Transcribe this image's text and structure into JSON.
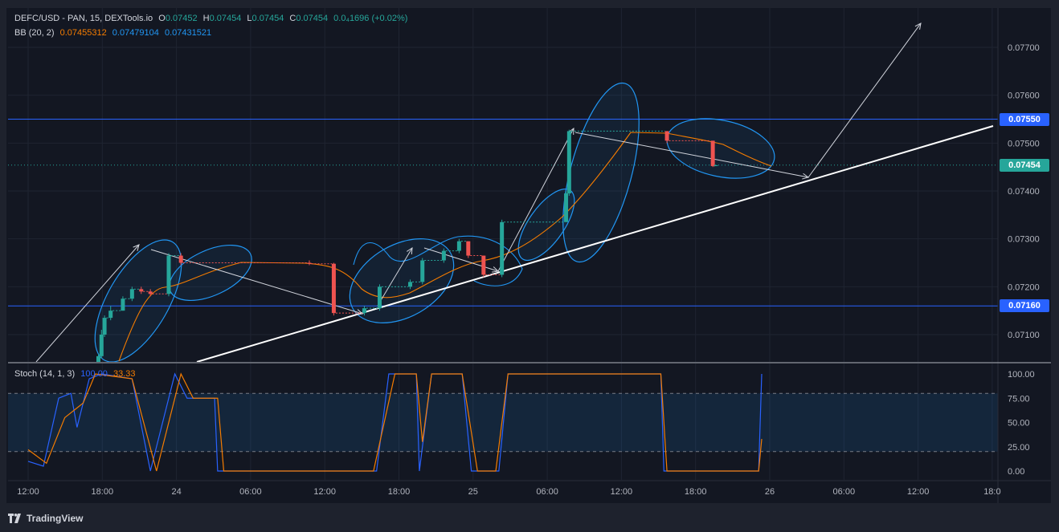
{
  "header": {
    "symbol": "DEFC/USD - PAN, 15, DEXTools.io",
    "o_label": "O",
    "o_value": "0.07452",
    "h_label": "H",
    "h_value": "0.07454",
    "l_label": "L",
    "l_value": "0.07454",
    "c_label": "C",
    "c_value": "0.07454",
    "change": "0.0₄1696 (+0.02%)"
  },
  "bb": {
    "label": "BB (20, 2)",
    "basis": "0.07455312",
    "upper": "0.07479104",
    "lower": "0.07431521"
  },
  "stoch": {
    "label": "Stoch (14, 1, 3)",
    "k_value": "100.00",
    "d_value": "33.33"
  },
  "price_axis": [
    "0.07700",
    "0.07600",
    "0.07500",
    "0.07400",
    "0.07300",
    "0.07200",
    "0.07100"
  ],
  "price_labels": {
    "resistance": "0.07550",
    "last": "0.07454",
    "support": "0.07160"
  },
  "stoch_axis": [
    "100.00",
    "75.00",
    "50.00",
    "25.00",
    "0.00"
  ],
  "time_axis": [
    "12:00",
    "18:00",
    "24",
    "06:00",
    "12:00",
    "18:00",
    "25",
    "06:00",
    "12:00",
    "18:00",
    "26",
    "06:00",
    "12:00",
    "18:0"
  ],
  "footer": {
    "brand": "TradingView"
  },
  "colors": {
    "up": "#26a69a",
    "down": "#ef5350",
    "bb_basis": "#f57c00",
    "bb_band": "#2196f3",
    "stoch_k": "#2962ff",
    "stoch_d": "#f57c00",
    "hline": "#2962ff",
    "last_price": "#26a69a"
  },
  "chart_data": {
    "type": "candlestick",
    "y_range": [
      0.0704,
      0.0779
    ],
    "levels": {
      "resistance": 0.0755,
      "support": 0.0716,
      "last": 0.07454
    },
    "candles": [
      {
        "t": "23 17:45",
        "o": 0.0704,
        "h": 0.0706,
        "l": 0.0703,
        "c": 0.07055
      },
      {
        "t": "23 18:00",
        "o": 0.07055,
        "h": 0.0711,
        "l": 0.0705,
        "c": 0.071
      },
      {
        "t": "23 18:15",
        "o": 0.071,
        "h": 0.0714,
        "l": 0.07095,
        "c": 0.07135
      },
      {
        "t": "23 18:45",
        "o": 0.07135,
        "h": 0.0716,
        "l": 0.0713,
        "c": 0.0715
      },
      {
        "t": "23 19:45",
        "o": 0.0715,
        "h": 0.0718,
        "l": 0.0715,
        "c": 0.07175
      },
      {
        "t": "23 20:30",
        "o": 0.07175,
        "h": 0.072,
        "l": 0.0717,
        "c": 0.07195
      },
      {
        "t": "23 21:15",
        "o": 0.07195,
        "h": 0.072,
        "l": 0.07185,
        "c": 0.0719
      },
      {
        "t": "23 22:00",
        "o": 0.0719,
        "h": 0.07195,
        "l": 0.0718,
        "c": 0.07185
      },
      {
        "t": "23 23:30",
        "o": 0.07185,
        "h": 0.0727,
        "l": 0.0718,
        "c": 0.07265
      },
      {
        "t": "24 00:30",
        "o": 0.07265,
        "h": 0.0727,
        "l": 0.07245,
        "c": 0.0725
      },
      {
        "t": "24 11:00",
        "o": 0.0725,
        "h": 0.07255,
        "l": 0.07245,
        "c": 0.07248
      },
      {
        "t": "24 13:00",
        "o": 0.07248,
        "h": 0.0725,
        "l": 0.0714,
        "c": 0.07145
      },
      {
        "t": "24 15:30",
        "o": 0.07145,
        "h": 0.0716,
        "l": 0.0714,
        "c": 0.07155
      },
      {
        "t": "24 16:45",
        "o": 0.07155,
        "h": 0.07205,
        "l": 0.0715,
        "c": 0.072
      },
      {
        "t": "24 19:15",
        "o": 0.072,
        "h": 0.07215,
        "l": 0.07195,
        "c": 0.0721
      },
      {
        "t": "24 20:15",
        "o": 0.0721,
        "h": 0.0726,
        "l": 0.07205,
        "c": 0.07255
      },
      {
        "t": "24 22:00",
        "o": 0.07255,
        "h": 0.0728,
        "l": 0.0725,
        "c": 0.07275
      },
      {
        "t": "24 23:15",
        "o": 0.07275,
        "h": 0.073,
        "l": 0.0727,
        "c": 0.07295
      },
      {
        "t": "25 00:00",
        "o": 0.07295,
        "h": 0.07295,
        "l": 0.0726,
        "c": 0.07265
      },
      {
        "t": "25 01:15",
        "o": 0.07265,
        "h": 0.07265,
        "l": 0.0722,
        "c": 0.07225
      },
      {
        "t": "25 02:45",
        "o": 0.07225,
        "h": 0.0734,
        "l": 0.0722,
        "c": 0.07335
      },
      {
        "t": "25 08:00",
        "o": 0.07335,
        "h": 0.074,
        "l": 0.0734,
        "c": 0.07395
      },
      {
        "t": "25 08:15",
        "o": 0.07395,
        "h": 0.07528,
        "l": 0.0739,
        "c": 0.07525
      },
      {
        "t": "25 16:15",
        "o": 0.07525,
        "h": 0.07525,
        "l": 0.075,
        "c": 0.07505
      },
      {
        "t": "25 20:00",
        "o": 0.07505,
        "h": 0.07505,
        "l": 0.0745,
        "c": 0.07452
      },
      {
        "t": "25 20:15",
        "o": 0.07452,
        "h": 0.07454,
        "l": 0.07452,
        "c": 0.07454
      }
    ],
    "stoch_range": [
      0,
      100
    ],
    "stoch_levels": [
      80,
      20
    ],
    "stoch_k": [
      {
        "t": "23 12:00",
        "v": 10
      },
      {
        "t": "23 13:15",
        "v": 5
      },
      {
        "t": "23 14:30",
        "v": 75
      },
      {
        "t": "23 15:30",
        "v": 80
      },
      {
        "t": "23 16:00",
        "v": 45
      },
      {
        "t": "23 17:00",
        "v": 95
      },
      {
        "t": "23 18:00",
        "v": 100
      },
      {
        "t": "23 20:30",
        "v": 95
      },
      {
        "t": "23 22:00",
        "v": 0
      },
      {
        "t": "24 00:00",
        "v": 100
      },
      {
        "t": "24 01:00",
        "v": 75
      },
      {
        "t": "24 03:15",
        "v": 75
      },
      {
        "t": "24 03:30",
        "v": 0
      },
      {
        "t": "24 16:30",
        "v": 0
      },
      {
        "t": "24 17:30",
        "v": 100
      },
      {
        "t": "24 19:45",
        "v": 100
      },
      {
        "t": "24 20:00",
        "v": 0
      },
      {
        "t": "24 21:00",
        "v": 100
      },
      {
        "t": "24 23:30",
        "v": 100
      },
      {
        "t": "25 00:15",
        "v": 0
      },
      {
        "t": "25 02:30",
        "v": 0
      },
      {
        "t": "25 03:15",
        "v": 100
      },
      {
        "t": "25 15:45",
        "v": 100
      },
      {
        "t": "25 16:00",
        "v": 0
      },
      {
        "t": "25 23:45",
        "v": 0
      },
      {
        "t": "26 00:00",
        "v": 100
      }
    ],
    "stoch_d": [
      {
        "t": "23 12:00",
        "v": 22
      },
      {
        "t": "23 13:30",
        "v": 8
      },
      {
        "t": "23 15:00",
        "v": 55
      },
      {
        "t": "23 16:30",
        "v": 70
      },
      {
        "t": "23 17:30",
        "v": 100
      },
      {
        "t": "23 20:30",
        "v": 95
      },
      {
        "t": "23 22:30",
        "v": 0
      },
      {
        "t": "24 00:30",
        "v": 100
      },
      {
        "t": "24 01:30",
        "v": 75
      },
      {
        "t": "24 03:30",
        "v": 75
      },
      {
        "t": "24 04:00",
        "v": 0
      },
      {
        "t": "24 16:15",
        "v": 0
      },
      {
        "t": "24 18:00",
        "v": 100
      },
      {
        "t": "24 19:45",
        "v": 100
      },
      {
        "t": "24 20:15",
        "v": 30
      },
      {
        "t": "24 21:00",
        "v": 100
      },
      {
        "t": "24 23:30",
        "v": 100
      },
      {
        "t": "25 00:45",
        "v": 0
      },
      {
        "t": "25 02:15",
        "v": 0
      },
      {
        "t": "25 03:15",
        "v": 100
      },
      {
        "t": "25 15:45",
        "v": 100
      },
      {
        "t": "25 16:15",
        "v": 0
      },
      {
        "t": "25 23:45",
        "v": 0
      },
      {
        "t": "26 00:00",
        "v": 33
      }
    ]
  }
}
